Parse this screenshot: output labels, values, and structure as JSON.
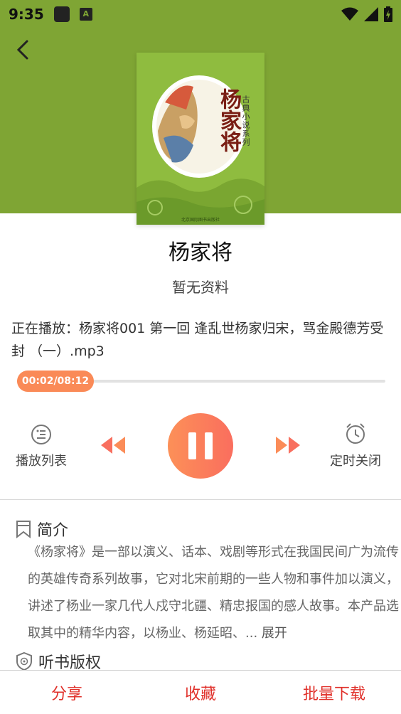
{
  "status_bar": {
    "time": "9:35",
    "notif_icon_letter": "A"
  },
  "header": {
    "back_icon": "chevron-left-icon",
    "bg_color": "#7fa534"
  },
  "cover": {
    "title": "杨家将",
    "series": "古典小说系列",
    "publisher": "北京国际图书出版社"
  },
  "book": {
    "title": "杨家将",
    "author": "暂无资料"
  },
  "now_playing": "正在播放：杨家将001 第一回 逢乱世杨家归宋，骂金殿德芳受封 （一）.mp3",
  "progress": {
    "time_label": "00:02/08:12",
    "fraction": 0.004
  },
  "controls": {
    "playlist_label": "播放列表",
    "timer_label": "定时关闭",
    "rewind_icon": "rewind-icon",
    "forward_icon": "fast-forward-icon",
    "pause_icon": "pause-icon"
  },
  "intro": {
    "heading": "简介",
    "text": "《杨家将》是一部以演义、话本、戏剧等形式在我国民间广为流传的英雄传奇系列故事，它对北宋前期的一些人物和事件加以演义，讲述了杨业一家几代人戍守北疆、精忠报国的感人故事。本产品选取其中的精华内容，以杨业、杨延昭、...",
    "expand": "展开"
  },
  "copyright": {
    "heading": "听书版权"
  },
  "bottom_bar": {
    "share": "分享",
    "favorite": "收藏",
    "batch_download": "批量下载"
  },
  "colors": {
    "accent": "#fa8a57",
    "bottom_text": "#e0302a"
  }
}
